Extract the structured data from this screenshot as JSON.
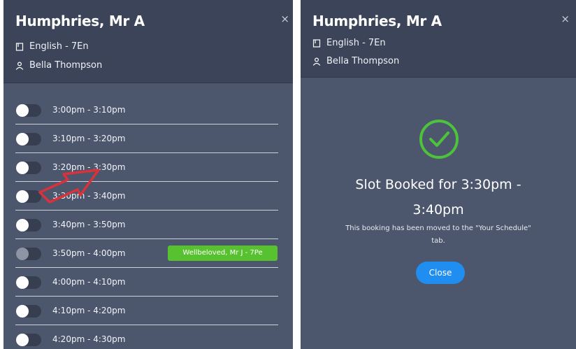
{
  "left_panel": {
    "teacher_name": "Humphries, Mr A",
    "close_icon": "×",
    "subject": "English - 7En",
    "student": "Bella Thompson",
    "slots": [
      {
        "time": "3:00pm - 3:10pm",
        "state": "off"
      },
      {
        "time": "3:10pm - 3:20pm",
        "state": "off"
      },
      {
        "time": "3:20pm - 3:30pm",
        "state": "off"
      },
      {
        "time": "3:30pm - 3:40pm",
        "state": "off"
      },
      {
        "time": "3:40pm - 3:50pm",
        "state": "off"
      },
      {
        "time": "3:50pm - 4:00pm",
        "state": "disabled",
        "badge": "Wellbeloved, Mr J - 7Pe"
      },
      {
        "time": "4:00pm - 4:10pm",
        "state": "off"
      },
      {
        "time": "4:10pm - 4:20pm",
        "state": "off"
      },
      {
        "time": "4:20pm - 4:30pm",
        "state": "off"
      }
    ]
  },
  "right_panel": {
    "teacher_name": "Humphries, Mr A",
    "close_icon": "×",
    "subject": "English - 7En",
    "student": "Bella Thompson",
    "confirmation_line1": "Slot Booked for 3:30pm -",
    "confirmation_line2": "3:40pm",
    "message_line1": "This booking has been moved to the \"Your Schedule\"",
    "message_line2": "tab.",
    "close_button": "Close"
  },
  "icons": {
    "subject": "book-icon",
    "student": "person-icon",
    "success": "check-circle-icon",
    "annotation": "red-arrow-icon"
  },
  "colors": {
    "panel_bg": "#4c566d",
    "header_bg": "#3b4459",
    "toggle_track": "#363e50",
    "badge": "#57c130",
    "success": "#4cc33b",
    "close_button": "#1f8ef0",
    "annotation_arrow": "#d8323a"
  }
}
